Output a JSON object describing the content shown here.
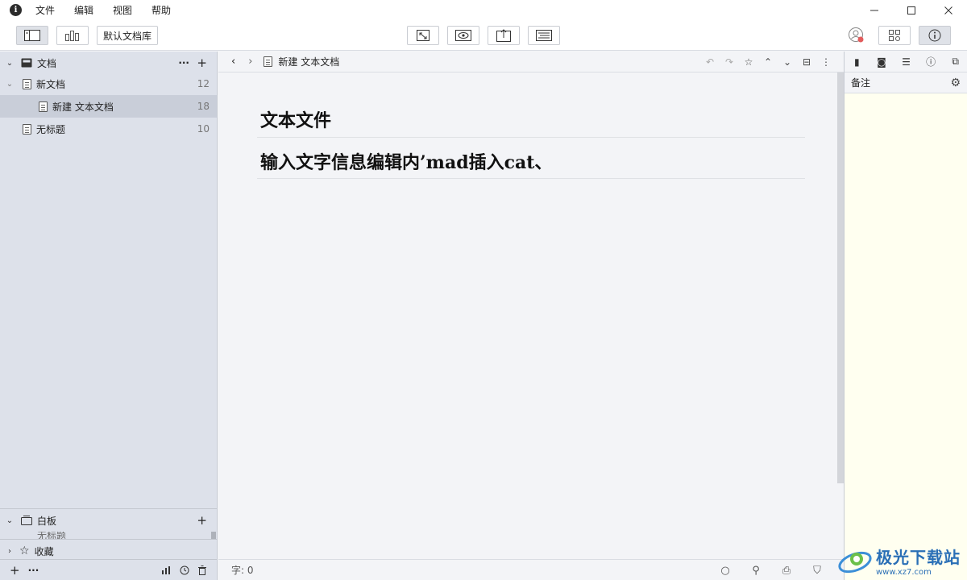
{
  "menu": [
    "文件",
    "编辑",
    "视图",
    "帮助"
  ],
  "toolbar": {
    "library_label": "默认文档库"
  },
  "sidebar": {
    "section_docs": "文档",
    "items": [
      {
        "label": "新文档",
        "count": "12"
      },
      {
        "label": "新建 文本文档",
        "count": "18"
      },
      {
        "label": "无标题",
        "count": "10"
      }
    ],
    "section_whiteboard": "白板",
    "whiteboard_partial": "无标题",
    "section_favorites": "收藏"
  },
  "editor": {
    "breadcrumb": "新建 文本文档",
    "lines": [
      "文本文件",
      "输入文字信息编辑内’mad插入cat、"
    ]
  },
  "status": {
    "word_count": "字: 0"
  },
  "right_panel": {
    "header": "备注"
  },
  "colors": {
    "sidebar_bg": "#dde1ea",
    "notes_bg": "#fffff0",
    "selected_row": "#c9ced9"
  },
  "watermark": {
    "big": "极光下载站",
    "small": "www.xz7.com"
  }
}
